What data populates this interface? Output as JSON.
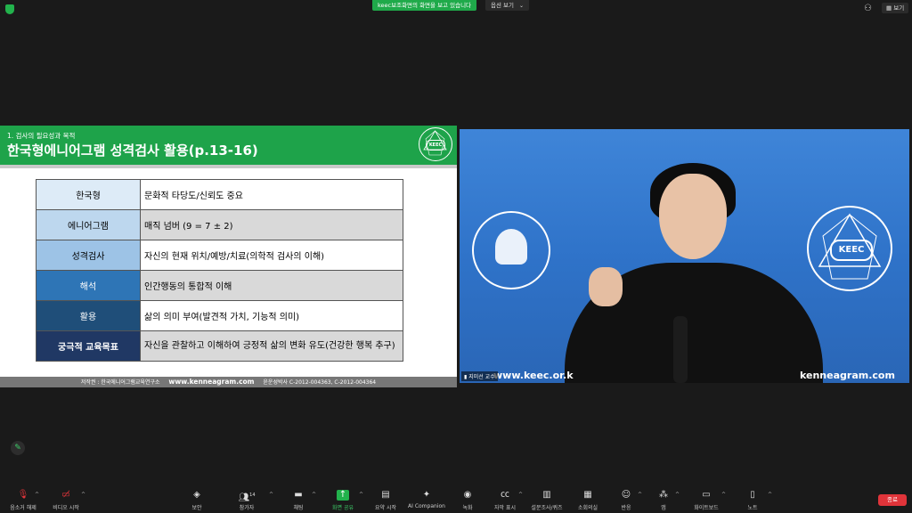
{
  "topbar": {
    "share_banner": "keec보조화면의 화면을 보고 있습니다",
    "view_options": "옵션 보기",
    "view_button": "보기"
  },
  "slide": {
    "subtitle": "1. 검사의 필요성과 목적",
    "title": "한국형에니어그램 성격검사 활용(p.13-16)",
    "logo_text": "KEEC",
    "rows": [
      {
        "key": "한국형",
        "value": "문화적 타당도/신뢰도 중요"
      },
      {
        "key": "에니어그램",
        "value": "매직 넘버 (9 = 7 ± 2)"
      },
      {
        "key": "성격검사",
        "value": "자신의 현재 위치/예방/치료(의학적 검사의 이해)"
      },
      {
        "key": "해석",
        "value": "인간행동의 통합적 이해"
      },
      {
        "key": "활용",
        "value": "삶의 의미 부여(발견적 가치, 기능적 의미)"
      },
      {
        "key": "궁극적 교육목표",
        "value": "자신을 관찰하고 이해하여 긍정적 삶의 변화 유도(건강한 행복 추구)"
      }
    ],
    "footer_copyright": "저작권 : 한국에니어그램교육연구소",
    "footer_url": "www.kenneagram.com",
    "footer_reg": "윤운성박사 C-2012-004363, C-2012-004364"
  },
  "video": {
    "participant_name": "지미선 교수",
    "url_left": "www.keec.or.k",
    "url_right": "kenneagram.com",
    "logo_right_text": "KEEC"
  },
  "toolbar": {
    "audio": "음소거 해제",
    "video": "비디오 시작",
    "security": "보안",
    "participants": "참가자",
    "participants_count": "14",
    "chat": "채팅",
    "share": "화면 공유",
    "summary": "요약 시작",
    "ai": "AI Companion",
    "record": "녹화",
    "captions": "자막 표시",
    "polls": "설문조사/퀴즈",
    "breakout": "소회의실",
    "reactions": "반응",
    "apps": "앱",
    "whiteboard": "화이트보드",
    "notes": "노트",
    "leave": "종료"
  },
  "colors": {
    "zoom_green": "#22b24c",
    "slide_header_green": "#1ea34a",
    "leave_red": "#e0343a"
  }
}
